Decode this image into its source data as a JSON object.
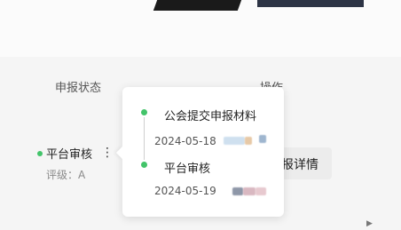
{
  "table": {
    "columns": {
      "status": "申报状态",
      "actions": "操作"
    },
    "row": {
      "status": "平台审核",
      "grade": "评级：A",
      "action_label": "报详情"
    }
  },
  "popover": {
    "timeline": [
      {
        "title": "公会提交申报材料",
        "date": "2024-05-18"
      },
      {
        "title": "平台审核",
        "date": "2024-05-19"
      }
    ]
  },
  "colors": {
    "status_dot": "#43c46a"
  },
  "icons": {
    "more": "kebab-vertical-icon",
    "scroll": "caret-right-icon"
  }
}
